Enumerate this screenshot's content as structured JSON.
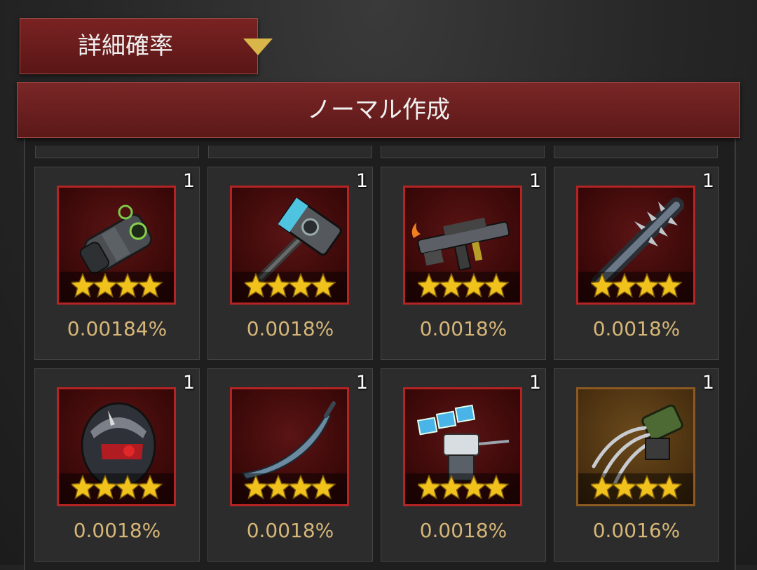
{
  "dropdown": {
    "label": "詳細確率"
  },
  "section": {
    "title": "ノーマル作成"
  },
  "items": [
    {
      "icon": "gauntlet-icon",
      "qty": "1",
      "stars": 4,
      "rate": "0.00184%",
      "frame": "red"
    },
    {
      "icon": "hammer-icon",
      "qty": "1",
      "stars": 4,
      "rate": "0.0018%",
      "frame": "red"
    },
    {
      "icon": "rifle-icon",
      "qty": "1",
      "stars": 4,
      "rate": "0.0018%",
      "frame": "red"
    },
    {
      "icon": "spiked-club-icon",
      "qty": "1",
      "stars": 4,
      "rate": "0.0018%",
      "frame": "red"
    },
    {
      "icon": "helmet-icon",
      "qty": "1",
      "stars": 4,
      "rate": "0.0018%",
      "frame": "red"
    },
    {
      "icon": "curved-blade-icon",
      "qty": "1",
      "stars": 4,
      "rate": "0.0018%",
      "frame": "red"
    },
    {
      "icon": "turret-icon",
      "qty": "1",
      "stars": 4,
      "rate": "0.0018%",
      "frame": "red"
    },
    {
      "icon": "claw-icon",
      "qty": "1",
      "stars": 4,
      "rate": "0.0016%",
      "frame": "gold"
    }
  ],
  "colors": {
    "accent_red": "#7a2222",
    "rate_text": "#d6b678",
    "star": "#f2c21c"
  }
}
